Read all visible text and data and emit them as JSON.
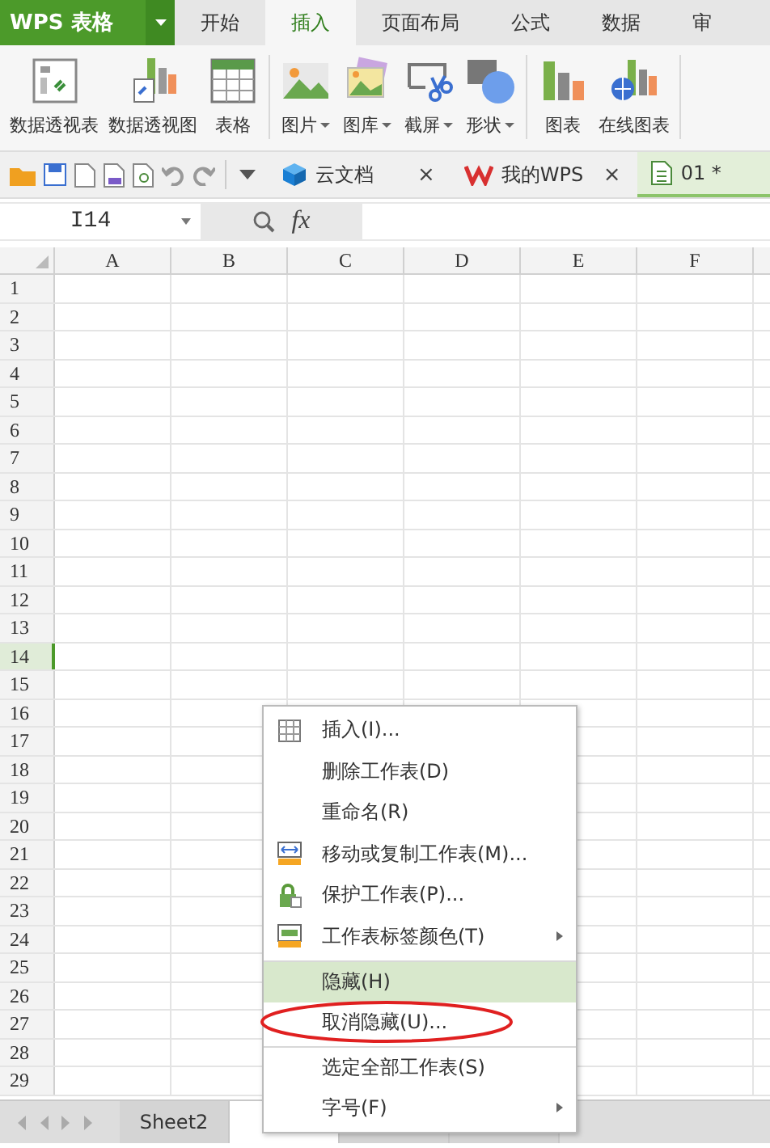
{
  "app": {
    "title": "WPS 表格"
  },
  "ribbon_tabs": [
    {
      "label": "开始",
      "selected": false
    },
    {
      "label": "插入",
      "selected": true
    },
    {
      "label": "页面布局",
      "selected": false
    },
    {
      "label": "公式",
      "selected": false
    },
    {
      "label": "数据",
      "selected": false
    },
    {
      "label": "审",
      "selected": false
    }
  ],
  "ribbon_groups": [
    [
      {
        "label": "数据透视表",
        "kind": "pivot",
        "has_menu": false
      },
      {
        "label": "数据透视图",
        "kind": "pivotchart",
        "has_menu": false
      },
      {
        "label": "表格",
        "kind": "table",
        "has_menu": false
      }
    ],
    [
      {
        "label": "图片",
        "kind": "picture",
        "has_menu": true
      },
      {
        "label": "图库",
        "kind": "gallery",
        "has_menu": true
      },
      {
        "label": "截屏",
        "kind": "screenshot",
        "has_menu": true
      },
      {
        "label": "形状",
        "kind": "shape",
        "has_menu": true
      }
    ],
    [
      {
        "label": "图表",
        "kind": "chart",
        "has_menu": false
      },
      {
        "label": "在线图表",
        "kind": "onlinechart",
        "has_menu": false
      }
    ]
  ],
  "doc_tabs": [
    {
      "label": "云文档",
      "kind": "cube",
      "close": "×",
      "selected": false
    },
    {
      "label": "我的WPS",
      "kind": "wps",
      "close": "×",
      "selected": false
    },
    {
      "label": "01 *",
      "kind": "doc",
      "selected": true
    }
  ],
  "formula_bar": {
    "name_box": "I14",
    "fx": "fx"
  },
  "columns": [
    "A",
    "B",
    "C",
    "D",
    "E",
    "F"
  ],
  "rows": [
    {
      "label": "1",
      "selected": false
    },
    {
      "label": "2",
      "selected": false
    },
    {
      "label": "3",
      "selected": false
    },
    {
      "label": "4",
      "selected": false
    },
    {
      "label": "5",
      "selected": false
    },
    {
      "label": "6",
      "selected": false
    },
    {
      "label": "7",
      "selected": false
    },
    {
      "label": "8",
      "selected": false
    },
    {
      "label": "9",
      "selected": false
    },
    {
      "label": "10",
      "selected": false
    },
    {
      "label": "11",
      "selected": false
    },
    {
      "label": "12",
      "selected": false
    },
    {
      "label": "13",
      "selected": false
    },
    {
      "label": "14",
      "selected": true
    },
    {
      "label": "15",
      "selected": false
    },
    {
      "label": "16",
      "selected": false
    },
    {
      "label": "17",
      "selected": false
    },
    {
      "label": "18",
      "selected": false
    },
    {
      "label": "19",
      "selected": false
    },
    {
      "label": "20",
      "selected": false
    },
    {
      "label": "21",
      "selected": false
    },
    {
      "label": "22",
      "selected": false
    },
    {
      "label": "23",
      "selected": false
    },
    {
      "label": "24",
      "selected": false
    },
    {
      "label": "25",
      "selected": false
    },
    {
      "label": "26",
      "selected": false
    },
    {
      "label": "27",
      "selected": false
    },
    {
      "label": "28",
      "selected": false
    },
    {
      "label": "29",
      "selected": false
    }
  ],
  "sheet_tabs": [
    {
      "label": "Sheet2",
      "selected": false
    },
    {
      "selected": true
    },
    {
      "selected": false
    },
    {
      "selected": false
    }
  ],
  "context_menu": [
    {
      "label": "插入(I)...",
      "kind": "table",
      "submenu": false,
      "selected": false,
      "circled": false,
      "separator_before": false
    },
    {
      "label": "删除工作表(D)",
      "kind": "plain",
      "submenu": false,
      "selected": false,
      "circled": false,
      "separator_before": false
    },
    {
      "label": "重命名(R)",
      "kind": "plain",
      "submenu": false,
      "selected": false,
      "circled": false,
      "separator_before": false
    },
    {
      "label": "移动或复制工作表(M)...",
      "kind": "move",
      "submenu": false,
      "selected": false,
      "circled": false,
      "separator_before": false
    },
    {
      "label": "保护工作表(P)...",
      "kind": "lock",
      "submenu": false,
      "selected": false,
      "circled": false,
      "separator_before": false
    },
    {
      "label": "工作表标签颜色(T)",
      "kind": "tabcolor",
      "submenu": true,
      "selected": false,
      "circled": false,
      "separator_before": false
    },
    {
      "label": "隐藏(H)",
      "kind": "plain",
      "submenu": false,
      "selected": true,
      "circled": false,
      "separator_before": true
    },
    {
      "label": "取消隐藏(U)...",
      "kind": "plain",
      "submenu": false,
      "selected": false,
      "circled": true,
      "separator_before": false
    },
    {
      "label": "选定全部工作表(S)",
      "kind": "plain",
      "submenu": false,
      "selected": false,
      "circled": false,
      "separator_before": true
    },
    {
      "label": "字号(F)",
      "kind": "plain",
      "submenu": true,
      "selected": false,
      "circled": false,
      "separator_before": false
    }
  ]
}
